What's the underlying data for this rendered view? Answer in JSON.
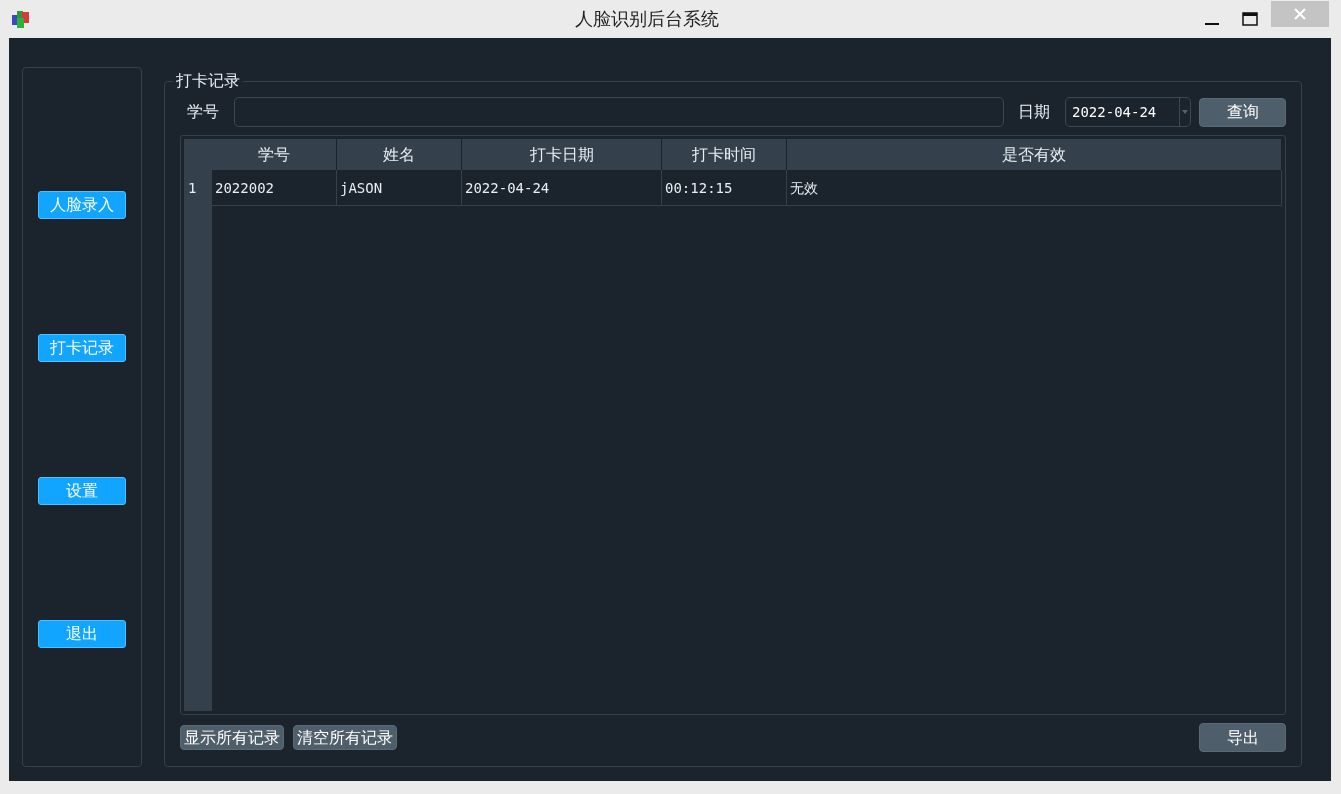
{
  "window": {
    "title": "人脸识别后台系统"
  },
  "sidebar": {
    "buttons": [
      "人脸录入",
      "打卡记录",
      "设置",
      "退出"
    ]
  },
  "group": {
    "title": "打卡记录"
  },
  "filter": {
    "student_id_label": "学号",
    "date_label": "日期",
    "date_value": "2022-04-24",
    "query_button": "查询"
  },
  "table": {
    "columns": [
      "学号",
      "姓名",
      "打卡日期",
      "打卡时间",
      "是否有效"
    ],
    "rows": [
      {
        "number": "1",
        "cells": [
          "2022002",
          "jASON",
          "2022-04-24",
          "00:12:15",
          "无效"
        ]
      }
    ]
  },
  "footer": {
    "buttons": [
      "显示所有记录",
      "清空所有记录"
    ],
    "export_button": "导出"
  }
}
